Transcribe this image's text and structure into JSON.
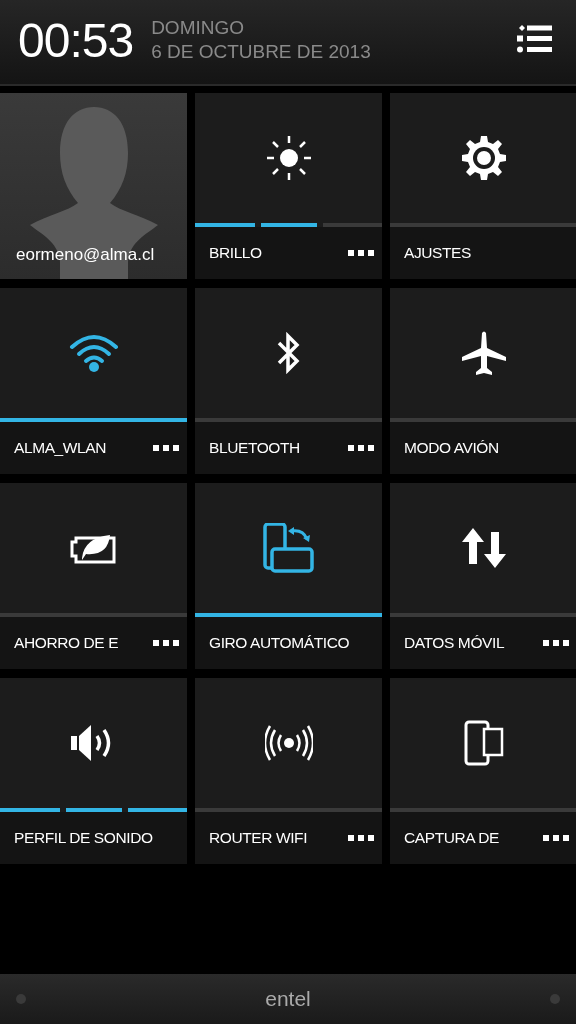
{
  "header": {
    "time": "00:53",
    "weekday": "DOMINGO",
    "date": "6 DE OCTUBRE DE 2013"
  },
  "tiles": [
    {
      "kind": "account",
      "label": "eormeno@alma.cl"
    },
    {
      "kind": "segmented",
      "label": "BRILLO",
      "level": 0.67,
      "more": true
    },
    {
      "kind": "toggle",
      "label": "AJUSTES",
      "on": false,
      "more": false
    },
    {
      "kind": "toggle",
      "label": "ALMA_WLAN",
      "on": true,
      "more": true
    },
    {
      "kind": "toggle",
      "label": "BLUETOOTH",
      "on": false,
      "more": true
    },
    {
      "kind": "toggle",
      "label": "MODO AVIÓN",
      "on": false,
      "more": false
    },
    {
      "kind": "toggle",
      "label": "AHORRO DE E",
      "on": false,
      "more": true
    },
    {
      "kind": "toggle",
      "label": "GIRO AUTOMÁTICO",
      "on": true,
      "more": false
    },
    {
      "kind": "toggle",
      "label": "DATOS MÓVIL",
      "on": false,
      "more": true
    },
    {
      "kind": "segmented",
      "label": "PERFIL DE SONIDO",
      "level": 1,
      "more": false
    },
    {
      "kind": "toggle",
      "label": "ROUTER WIFI",
      "on": false,
      "more": true
    },
    {
      "kind": "toggle",
      "label": "CAPTURA DE",
      "on": false,
      "more": true
    }
  ],
  "carrier": "entel"
}
